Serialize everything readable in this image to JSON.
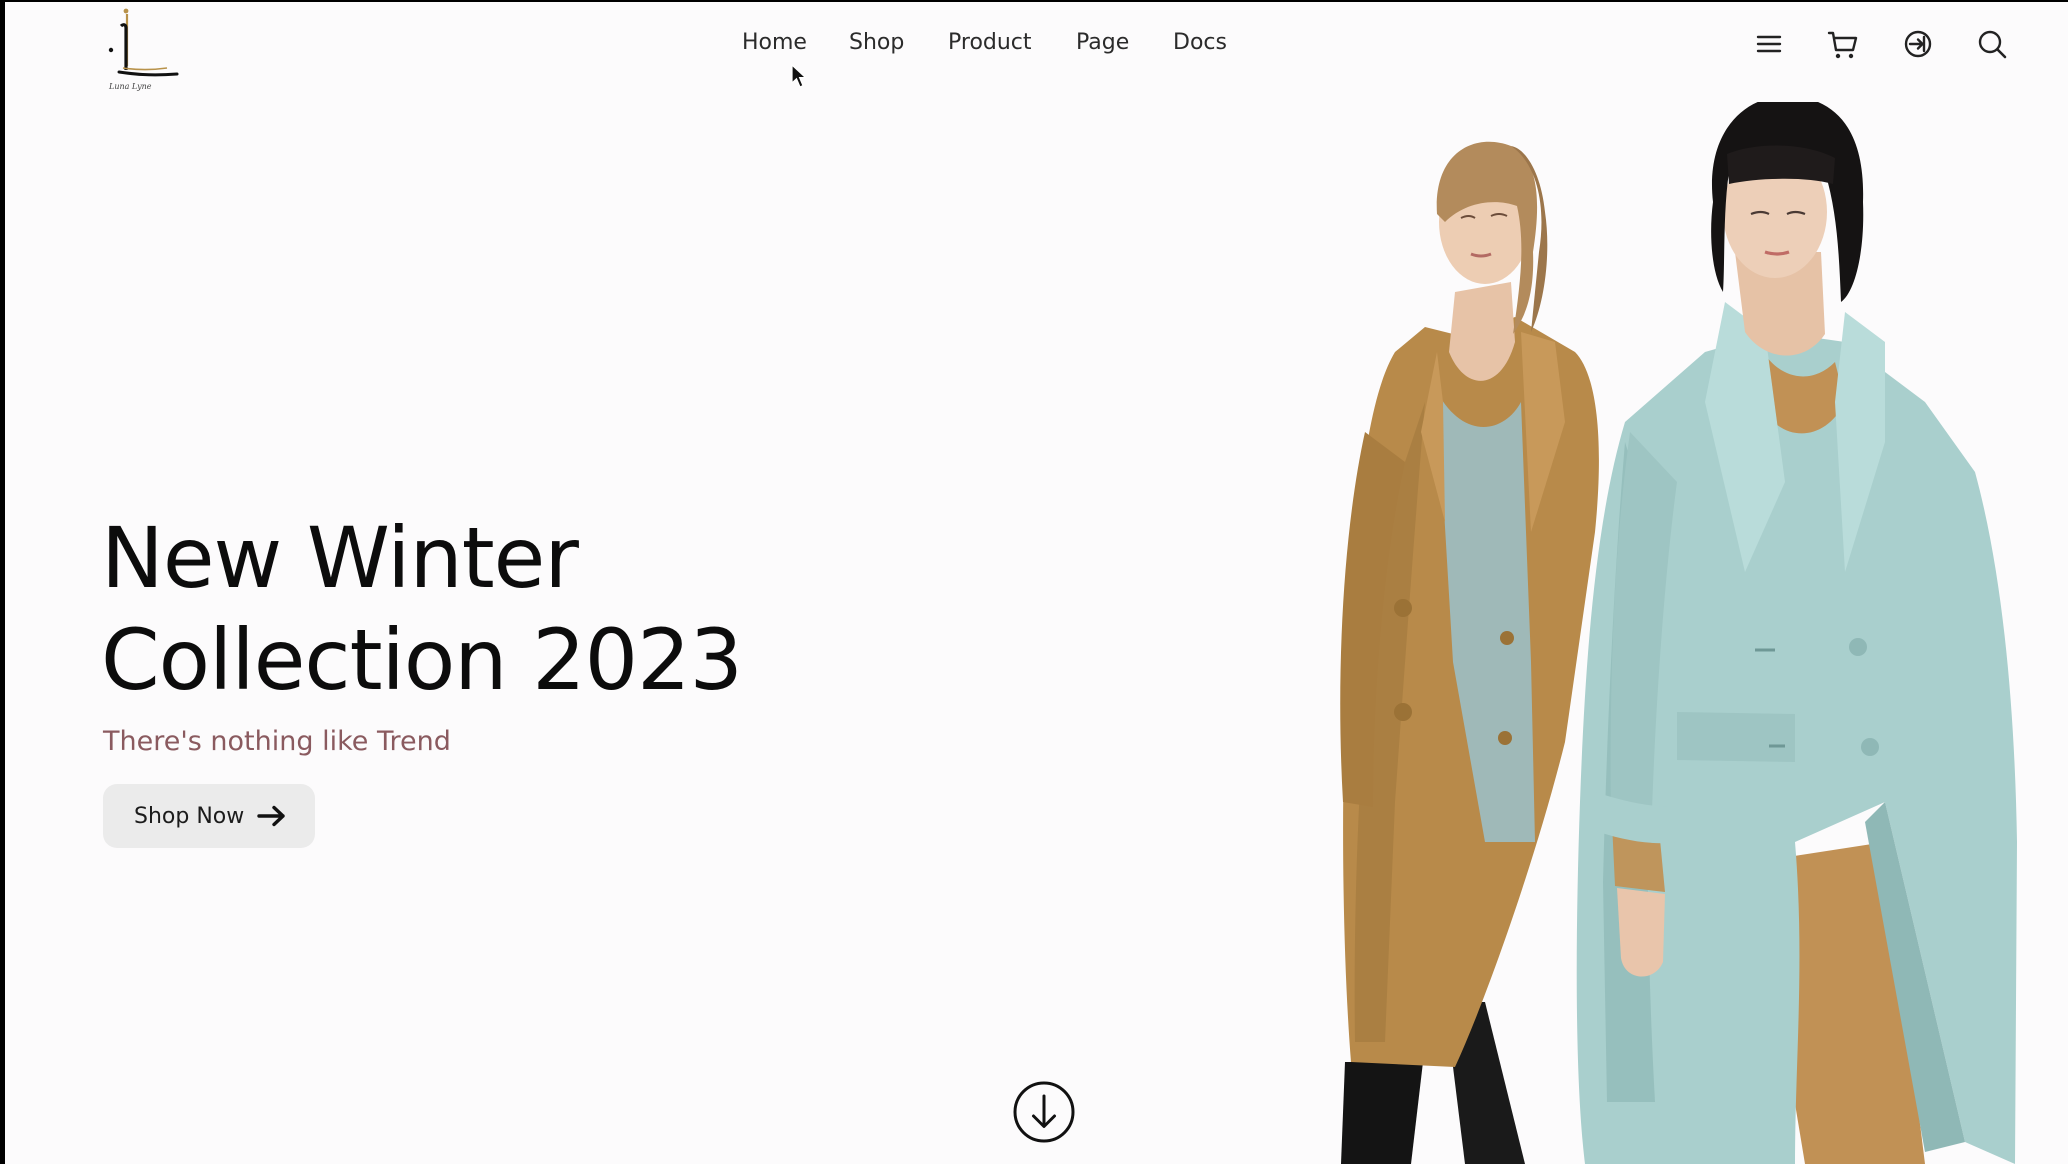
{
  "brand": {
    "logo_letter": "L",
    "logo_script": "Luna Lyne"
  },
  "nav": {
    "items": [
      {
        "label": "Home"
      },
      {
        "label": "Shop"
      },
      {
        "label": "Product"
      },
      {
        "label": "Page"
      },
      {
        "label": "Docs"
      }
    ]
  },
  "header_icons": [
    "menu-icon",
    "cart-icon",
    "login-icon",
    "search-icon"
  ],
  "hero": {
    "title_line1": "New Winter",
    "title_line2": "Collection 2023",
    "subtitle": "There's nothing like Trend",
    "cta_label": "Shop Now",
    "cta_icon": "arrow-right-icon",
    "scroll_icon": "arrow-down-circle-icon"
  },
  "colors": {
    "background": "#fcfbfc",
    "text": "#0c0c0c",
    "subtitle": "#8a5a5f",
    "button_bg": "#ebebeb",
    "logo_gold": "#b8924a",
    "coat_camel": "#b88a4a",
    "coat_mint": "#a9cfcd"
  }
}
